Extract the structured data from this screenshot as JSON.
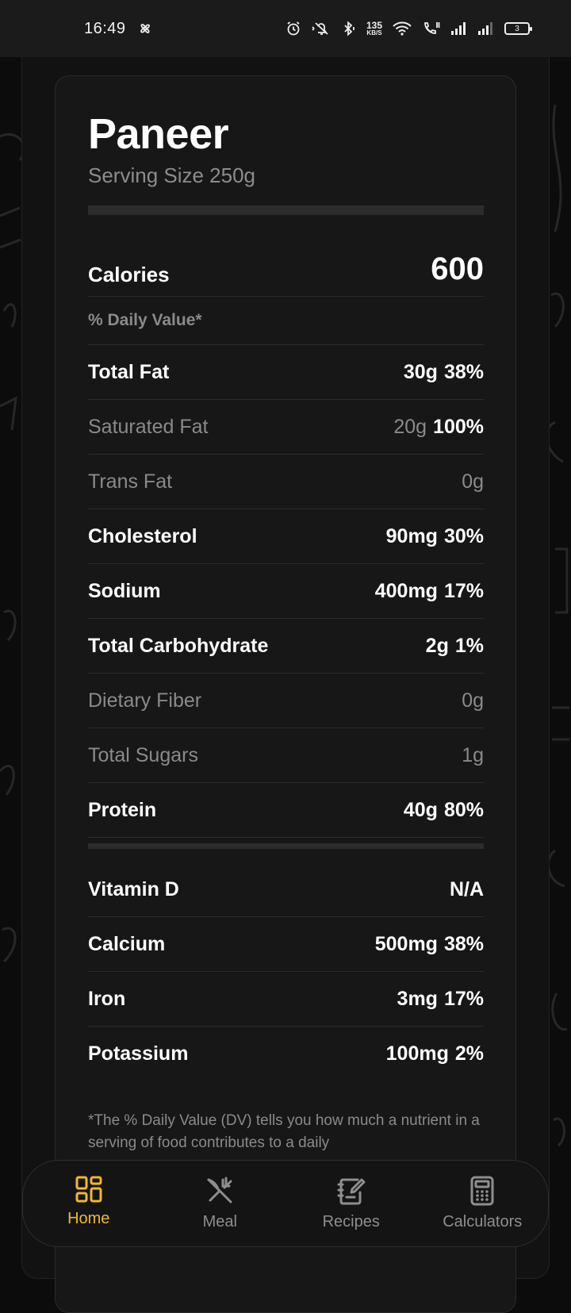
{
  "status_bar": {
    "time": "16:49",
    "net_speed_value": "135",
    "net_speed_unit": "KB/S",
    "battery": "3"
  },
  "food": {
    "name": "Paneer",
    "serving": "Serving Size 250g"
  },
  "calories": {
    "label": "Calories",
    "value": "600"
  },
  "daily_value_header": "% Daily Value*",
  "nutrients": [
    {
      "label": "Total Fat",
      "amount": "30g",
      "percent": "38%",
      "sub": false
    },
    {
      "label": "Saturated Fat",
      "amount": "20g",
      "percent": "100%",
      "sub": true
    },
    {
      "label": "Trans Fat",
      "amount": "0g",
      "percent": "",
      "sub": true
    },
    {
      "label": "Cholesterol",
      "amount": "90mg",
      "percent": "30%",
      "sub": false
    },
    {
      "label": "Sodium",
      "amount": "400mg",
      "percent": "17%",
      "sub": false
    },
    {
      "label": "Total Carbohydrate",
      "amount": "2g",
      "percent": "1%",
      "sub": false
    },
    {
      "label": "Dietary Fiber",
      "amount": "0g",
      "percent": "",
      "sub": true
    },
    {
      "label": "Total Sugars",
      "amount": "1g",
      "percent": "",
      "sub": true
    },
    {
      "label": "Protein",
      "amount": "40g",
      "percent": "80%",
      "sub": false
    }
  ],
  "vitamins": [
    {
      "label": "Vitamin D",
      "amount": "N/A",
      "percent": ""
    },
    {
      "label": "Calcium",
      "amount": "500mg",
      "percent": "38%"
    },
    {
      "label": "Iron",
      "amount": "3mg",
      "percent": "17%"
    },
    {
      "label": "Potassium",
      "amount": "100mg",
      "percent": "2%"
    }
  ],
  "footnote": "*The % Daily Value (DV) tells you how much a nutrient in a serving of food contributes to a daily",
  "nav": {
    "home": "Home",
    "meal": "Meal",
    "recipes": "Recipes",
    "calculators": "Calculators",
    "active_color": "#f0b832",
    "inactive_color": "#8e8e8e"
  }
}
